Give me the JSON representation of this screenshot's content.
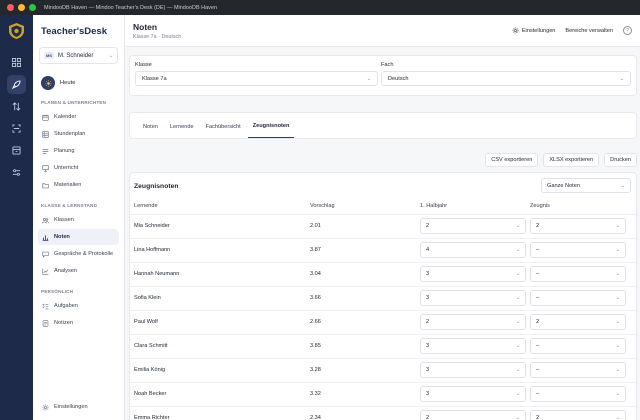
{
  "window": {
    "title": "MindooDB Haven — Mindoo Teacher's Desk (DE) — MindooDB Haven"
  },
  "brand": {
    "part1": "Teacher's ",
    "part2": "Desk"
  },
  "user": {
    "initials": "MS",
    "name": "M. Schneider"
  },
  "sidebar": {
    "today": "Heute",
    "sections": [
      {
        "label": "PLANEN & UNTERRICHTEN",
        "items": [
          "Kalender",
          "Stundenplan",
          "Planung",
          "Unterricht",
          "Materialien"
        ]
      },
      {
        "label": "KLASSE & LERNSTAND",
        "items": [
          "Klassen",
          "Noten",
          "Gespräche & Protokolle",
          "Analysen"
        ]
      },
      {
        "label": "PERSÖNLICH",
        "items": [
          "Aufgaben",
          "Notizen"
        ]
      }
    ],
    "settings": "Einstellungen"
  },
  "header": {
    "title": "Noten",
    "breadcrumb": "Klasse 7a · Deutsch",
    "settings_btn": "Einstellungen",
    "manage_btn": "Bereiche verwalten",
    "help": "?"
  },
  "filters": {
    "class_label": "Klasse",
    "class_value": "Klasse 7a",
    "subject_label": "Fach",
    "subject_value": "Deutsch"
  },
  "tabs": [
    "Noten",
    "Lernende",
    "Fachübersicht",
    "Zeugnisnoten"
  ],
  "active_tab": "Zeugnisnoten",
  "exports": {
    "csv": "CSV exportieren",
    "xlsx": "XLSX exportieren",
    "print": "Drucken"
  },
  "grades": {
    "title": "Zeugnisnoten",
    "view": "Ganze Noten",
    "columns": {
      "student": "Lernende",
      "suggestion": "Vorschlag",
      "half": "1. Halbjahr",
      "report": "Zeugnis"
    },
    "rows": [
      {
        "name": "Mia Schneider",
        "suggestion": "2.01",
        "half": "2",
        "report": "2"
      },
      {
        "name": "Lina Hoffmann",
        "suggestion": "3.87",
        "half": "4",
        "report": "–"
      },
      {
        "name": "Hannah Neumann",
        "suggestion": "3.04",
        "half": "3",
        "report": "–"
      },
      {
        "name": "Sofia Klein",
        "suggestion": "3.66",
        "half": "3",
        "report": "–"
      },
      {
        "name": "Paul Wolf",
        "suggestion": "2.66",
        "half": "2",
        "report": "2"
      },
      {
        "name": "Clara Schmitt",
        "suggestion": "3.85",
        "half": "3",
        "report": "–"
      },
      {
        "name": "Emilia König",
        "suggestion": "3.28",
        "half": "3",
        "report": "–"
      },
      {
        "name": "Noah Becker",
        "suggestion": "3.32",
        "half": "3",
        "report": "–"
      },
      {
        "name": "Emma Richter",
        "suggestion": "2.34",
        "half": "2",
        "report": "2"
      }
    ]
  },
  "colors": {
    "rail": "#1e2a4a",
    "accent": "#2f3d68"
  }
}
